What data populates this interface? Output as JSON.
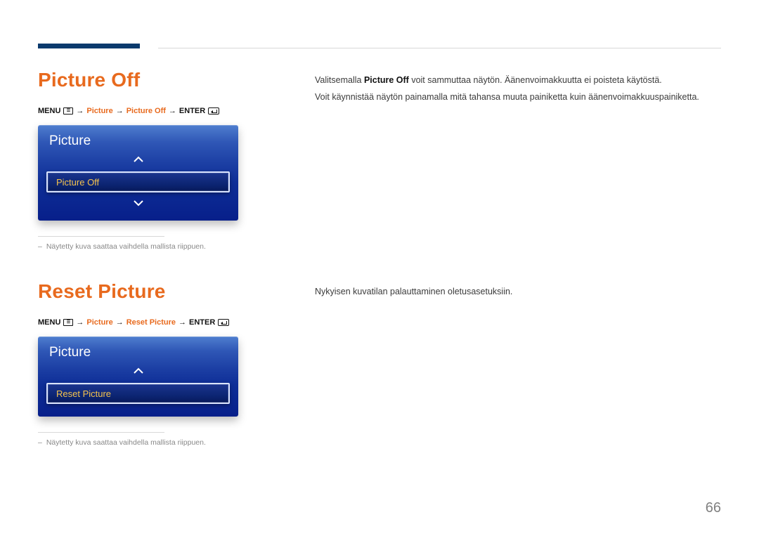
{
  "page_number": "66",
  "footnote": "Näytetty kuva saattaa vaihdella mallista riippuen.",
  "path_labels": {
    "menu": "MENU",
    "enter": "ENTER",
    "arrow": "→",
    "picture": "Picture"
  },
  "section1": {
    "title": "Picture Off",
    "path_item": "Picture Off",
    "osd_title": "Picture",
    "osd_selected": "Picture Off",
    "body": [
      {
        "pre": "Valitsemalla ",
        "bold": "Picture Off",
        "post": " voit sammuttaa näytön. Äänenvoimakkuutta ei poisteta käytöstä."
      },
      {
        "text": "Voit käynnistää näytön painamalla mitä tahansa muuta painiketta kuin äänenvoimakkuuspainiketta."
      }
    ]
  },
  "section2": {
    "title": "Reset Picture",
    "path_item": "Reset Picture",
    "osd_title": "Picture",
    "osd_selected": "Reset Picture",
    "body": [
      {
        "text": "Nykyisen kuvatilan palauttaminen oletusasetuksiin."
      }
    ]
  }
}
